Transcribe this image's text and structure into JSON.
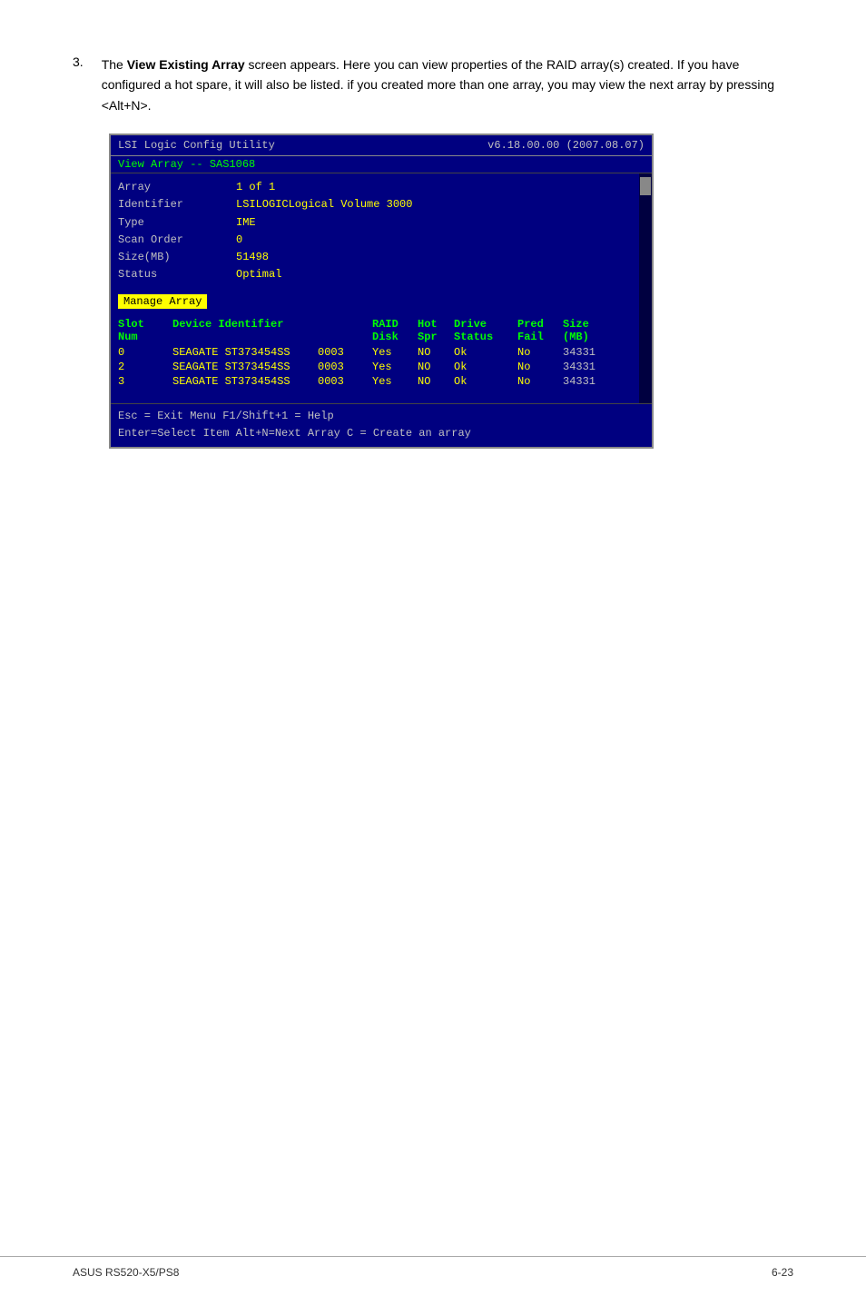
{
  "step": {
    "number": "3.",
    "description_part1": "The ",
    "bold_text": "View Existing Array",
    "description_part2": " screen appears. Here you can view properties of the RAID array(s) created. If you have configured a hot spare, it will also be listed. if you created more than one array, you may view the next array by pressing <Alt+N>."
  },
  "bios": {
    "header_title": "LSI Logic Config Utility",
    "header_version": "v6.18.00.00 (2007.08.07)",
    "subheader": "View Array -- SAS1068",
    "info": {
      "labels": [
        "Array",
        "Identifier",
        "Type",
        "Scan Order",
        "Size(MB)",
        "Status"
      ],
      "values": [
        "1 of 1",
        "LSILOGICLogical Volume  3000",
        "IME",
        "0",
        "51498",
        "Optimal"
      ]
    },
    "manage_array_btn": "Manage Array",
    "table": {
      "headers": {
        "slot": "Slot",
        "num": "Num",
        "device": "Device Identifier",
        "raid_disk": "RAID\nDisk",
        "hot_spr": "Hot\nSpr",
        "drive_status": "Drive\nStatus",
        "pred_fail": "Pred\nFail",
        "size_mb": "Size\n(MB)"
      },
      "rows": [
        {
          "slot": "0",
          "device": "SEAGATE ST373454SS",
          "id": "0003",
          "raid_disk": "Yes",
          "hot_spr": "NO",
          "drive_status": "Ok",
          "pred_fail": "No",
          "size": "34331"
        },
        {
          "slot": "2",
          "device": "SEAGATE ST373454SS",
          "id": "0003",
          "raid_disk": "Yes",
          "hot_spr": "NO",
          "drive_status": "Ok",
          "pred_fail": "No",
          "size": "34331"
        },
        {
          "slot": "3",
          "device": "SEAGATE ST373454SS",
          "id": "0003",
          "raid_disk": "Yes",
          "hot_spr": "NO",
          "drive_status": "Ok",
          "pred_fail": "No",
          "size": "34331"
        }
      ]
    },
    "footer_line1": "Esc = Exit Menu      F1/Shift+1 = Help",
    "footer_line2": "Enter=Select Item   Alt+N=Next Array   C = Create an array"
  },
  "page_footer": {
    "left": "ASUS RS520-X5/PS8",
    "right": "6-23"
  }
}
